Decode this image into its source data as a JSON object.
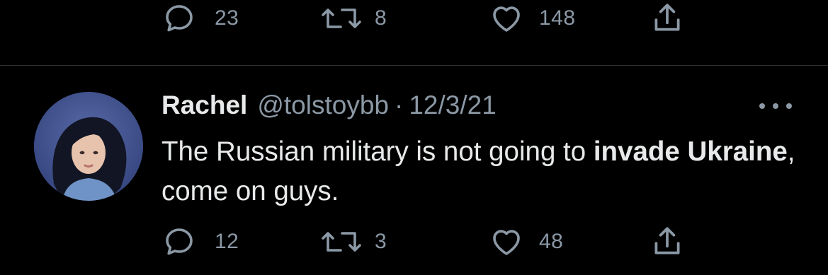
{
  "prev_tweet": {
    "reply_count": "23",
    "retweet_count": "8",
    "like_count": "148"
  },
  "tweet": {
    "display_name": "Rachel",
    "handle": "@tolstoybb",
    "separator": "·",
    "date": "12/3/21",
    "text_part1": "The Russian military is not going to ",
    "text_bold1": "invade Ukraine",
    "text_part2": ", come on guys.",
    "reply_count": "12",
    "retweet_count": "3",
    "like_count": "48"
  },
  "icons": {
    "reply": "reply-icon",
    "retweet": "retweet-icon",
    "like": "heart-icon",
    "share": "share-icon",
    "more": "more-icon"
  },
  "colors": {
    "background": "#000000",
    "text": "#e7e9ea",
    "secondary": "#8b98a5",
    "divider": "#2f3336"
  }
}
